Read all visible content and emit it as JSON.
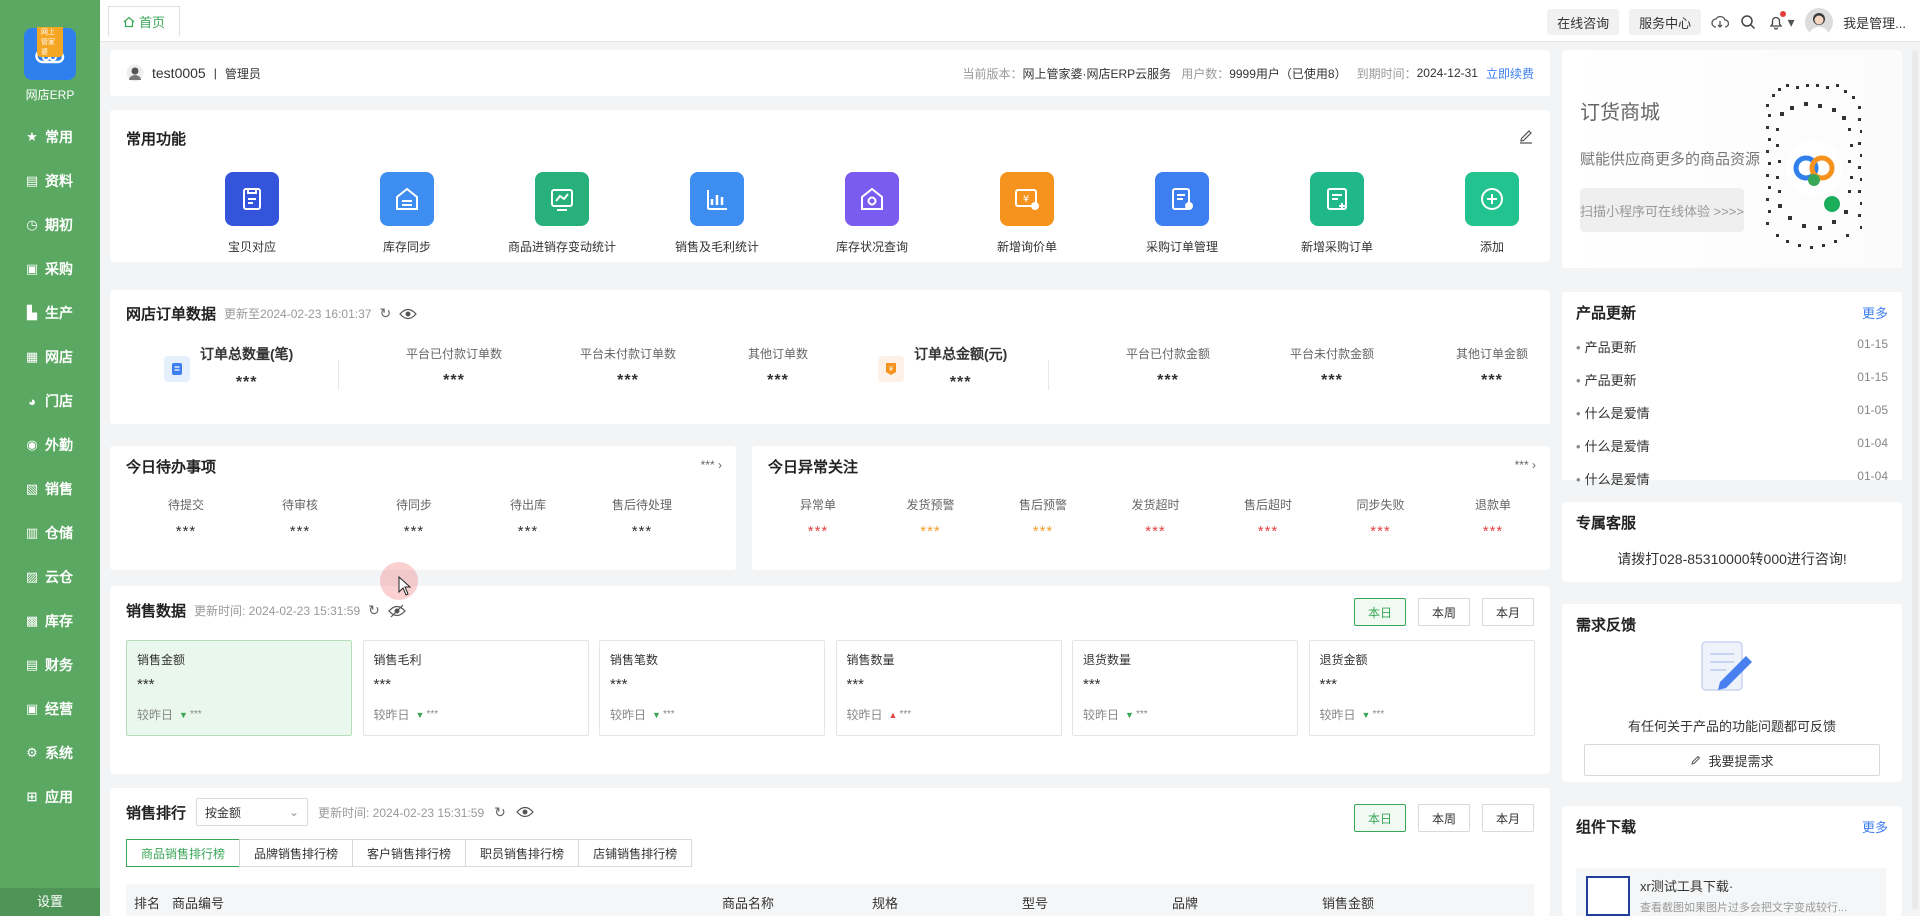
{
  "app": {
    "logo_tag": "网上管家婆",
    "name": "网店ERP"
  },
  "sidebar": {
    "items": [
      {
        "label": "常用",
        "icon": "star-icon"
      },
      {
        "label": "资料",
        "icon": "document-icon"
      },
      {
        "label": "期初",
        "icon": "clock-icon"
      },
      {
        "label": "采购",
        "icon": "purchase-icon"
      },
      {
        "label": "生产",
        "icon": "factory-icon"
      },
      {
        "label": "网店",
        "icon": "store-icon"
      },
      {
        "label": "门店",
        "icon": "pie-icon"
      },
      {
        "label": "外勤",
        "icon": "location-icon"
      },
      {
        "label": "销售",
        "icon": "sale-icon"
      },
      {
        "label": "仓储",
        "icon": "warehouse-icon"
      },
      {
        "label": "云仓",
        "icon": "cloud-warehouse-icon"
      },
      {
        "label": "库存",
        "icon": "inventory-icon"
      },
      {
        "label": "财务",
        "icon": "finance-icon"
      },
      {
        "label": "经营",
        "icon": "business-icon"
      },
      {
        "label": "系统",
        "icon": "gear-icon"
      },
      {
        "label": "应用",
        "icon": "plus-square-icon"
      }
    ],
    "settings": "设置"
  },
  "topbar": {
    "home_tab": "首页",
    "consult": "在线咨询",
    "service": "服务中心",
    "user": "我是管理..."
  },
  "account": {
    "username": "test0005",
    "separator": "|",
    "role": "管理员",
    "version_label": "当前版本：",
    "version": "网上管家婆·网店ERP云服务",
    "users_label": "用户数：",
    "users": "9999用户（已使用8）",
    "expiry_label": "到期时间：",
    "expiry": "2024-12-31",
    "renew": "立即续费"
  },
  "quick": {
    "title": "常用功能",
    "items": [
      {
        "label": "宝贝对应",
        "color": "#3455db"
      },
      {
        "label": "库存同步",
        "color": "#3d8ef0"
      },
      {
        "label": "商品进销存变动统计",
        "color": "#27b07a"
      },
      {
        "label": "销售及毛利统计",
        "color": "#3d8ef0"
      },
      {
        "label": "库存状况查询",
        "color": "#7b5cf0"
      },
      {
        "label": "新增询价单",
        "color": "#f5931e"
      },
      {
        "label": "采购订单管理",
        "color": "#3d7ef0"
      },
      {
        "label": "新增采购订单",
        "color": "#20b889"
      },
      {
        "label": "添加",
        "color": "#22c38e"
      }
    ]
  },
  "orders": {
    "title": "网店订单数据",
    "updated": "更新至2024-02-23 16:01:37",
    "count_title": "订单总数量(笔)",
    "count_value": "***",
    "count_stats": [
      {
        "label": "平台已付款订单数",
        "value": "***"
      },
      {
        "label": "平台未付款订单数",
        "value": "***"
      },
      {
        "label": "其他订单数",
        "value": "***"
      }
    ],
    "amount_title": "订单总金额(元)",
    "amount_value": "***",
    "amount_stats": [
      {
        "label": "平台已付款金额",
        "value": "***"
      },
      {
        "label": "平台未付款金额",
        "value": "***"
      },
      {
        "label": "其他订单金额",
        "value": "***"
      }
    ]
  },
  "todo": {
    "title": "今日待办事项",
    "more": "***",
    "items": [
      {
        "label": "待提交",
        "value": "***"
      },
      {
        "label": "待审核",
        "value": "***"
      },
      {
        "label": "待同步",
        "value": "***"
      },
      {
        "label": "待出库",
        "value": "***"
      },
      {
        "label": "售后待处理",
        "value": "***"
      }
    ]
  },
  "abnormal": {
    "title": "今日异常关注",
    "more": "***",
    "items": [
      {
        "label": "异常单",
        "value": "***",
        "color": "#e04848"
      },
      {
        "label": "发货预警",
        "value": "***",
        "color": "#f0a030"
      },
      {
        "label": "售后预警",
        "value": "***",
        "color": "#f0a030"
      },
      {
        "label": "发货超时",
        "value": "***",
        "color": "#e04848"
      },
      {
        "label": "售后超时",
        "value": "***",
        "color": "#e04848"
      },
      {
        "label": "同步失败",
        "value": "***",
        "color": "#e04848"
      },
      {
        "label": "退款单",
        "value": "***",
        "color": "#e04848"
      }
    ]
  },
  "sales": {
    "title": "销售数据",
    "updated": "更新时间: 2024-02-23 15:31:59",
    "ranges": [
      "本日",
      "本周",
      "本月"
    ],
    "compare_label": "较昨日",
    "metrics": [
      {
        "label": "销售金额",
        "value": "***",
        "delta": "***",
        "trend": "down"
      },
      {
        "label": "销售毛利",
        "value": "***",
        "delta": "***",
        "trend": "down"
      },
      {
        "label": "销售笔数",
        "value": "***",
        "delta": "***",
        "trend": "down"
      },
      {
        "label": "销售数量",
        "value": "***",
        "delta": "***",
        "trend": "up"
      },
      {
        "label": "退货数量",
        "value": "***",
        "delta": "***",
        "trend": "down"
      },
      {
        "label": "退货金额",
        "value": "***",
        "delta": "***",
        "trend": "down"
      }
    ]
  },
  "ranking": {
    "title": "销售排行",
    "sort_select": "按金额",
    "updated": "更新时间: 2024-02-23 15:31:59",
    "ranges": [
      "本日",
      "本周",
      "本月"
    ],
    "tabs": [
      "商品销售排行榜",
      "品牌销售排行榜",
      "客户销售排行榜",
      "职员销售排行榜",
      "店铺销售排行榜"
    ],
    "columns": [
      "排名",
      "商品编号",
      "商品名称",
      "规格",
      "型号",
      "品牌",
      "销售金额"
    ]
  },
  "mall": {
    "title": "订货商城",
    "subtitle": "赋能供应商更多的商品资源",
    "cta": "扫描小程序可在线体验 >>>>"
  },
  "updates": {
    "title": "产品更新",
    "more": "更多",
    "items": [
      {
        "label": "产品更新",
        "date": "01-15"
      },
      {
        "label": "产品更新",
        "date": "01-15"
      },
      {
        "label": "什么是爱情",
        "date": "01-05"
      },
      {
        "label": "什么是爱情",
        "date": "01-04"
      },
      {
        "label": "什么是爱情",
        "date": "01-04"
      }
    ]
  },
  "support": {
    "title": "专属客服",
    "text": "请拨打028-85310000转000进行咨询!"
  },
  "feedback": {
    "title": "需求反馈",
    "text": "有任何关于产品的功能问题都可反馈",
    "button": "我要提需求"
  },
  "downloads": {
    "title": "组件下载",
    "more": "更多",
    "item_title": "xr测试工具下载·",
    "item_desc": "查看截图如果图片过多会把文字变成较行..."
  }
}
